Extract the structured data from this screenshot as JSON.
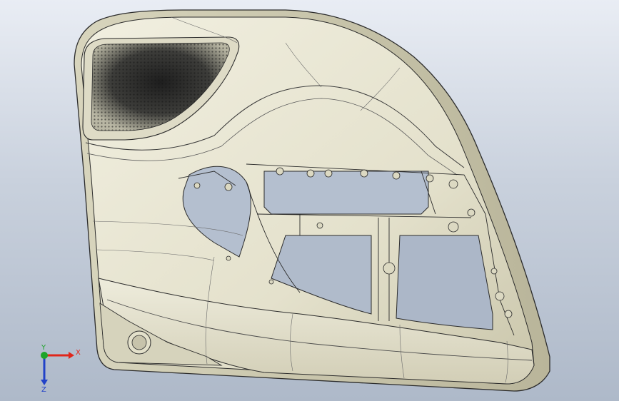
{
  "viewport": {
    "background_top": "#e9edf4",
    "background_bottom": "#aeb9c9"
  },
  "model": {
    "part_name": "",
    "panel_fill": "#e6e3d0",
    "panel_shade": "#cfcbb2",
    "edge_color": "#2b2b2b",
    "speaker_grille_dark": "#2a2a2a"
  },
  "triad": {
    "x_label": "X",
    "y_label": "Y",
    "z_label": "Z",
    "x_color": "#e0261b",
    "y_color": "#1fa52a",
    "z_color": "#2242c8"
  }
}
